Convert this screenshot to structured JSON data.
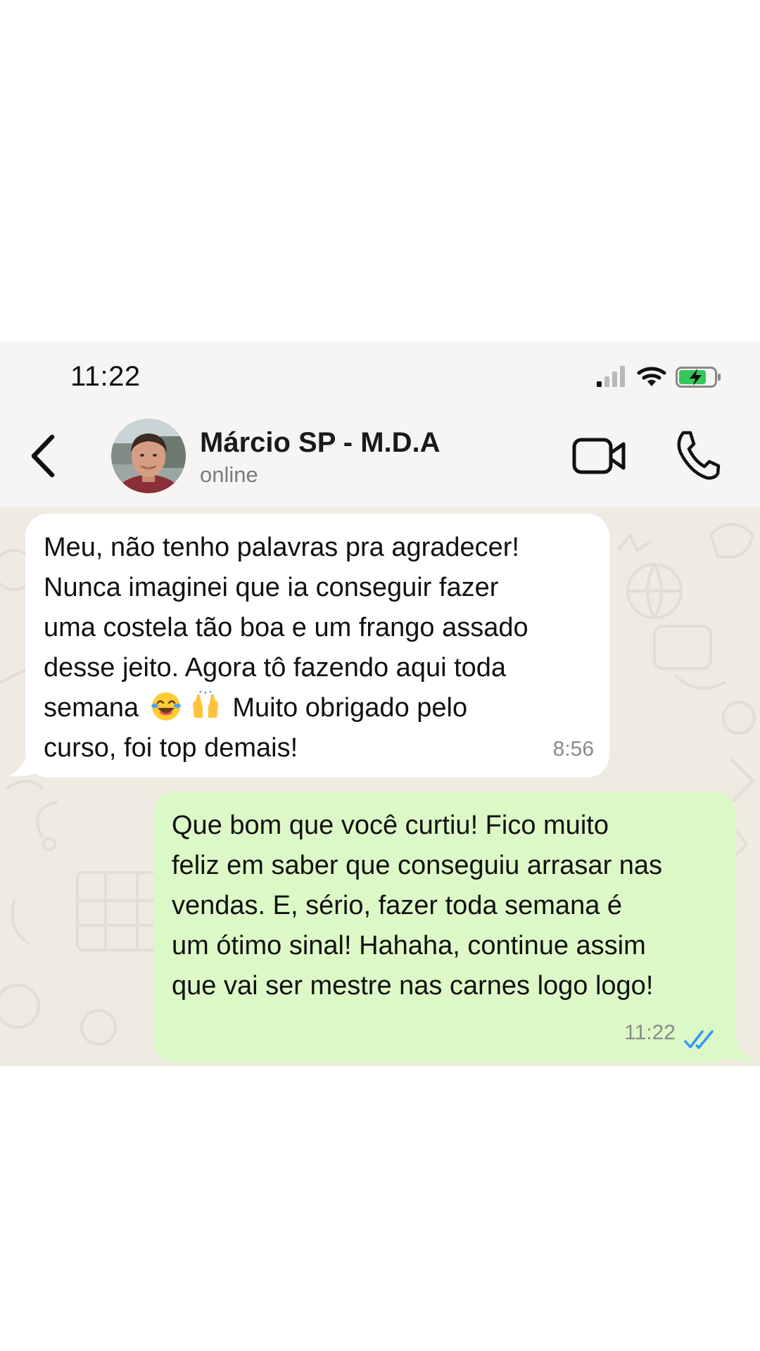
{
  "status_bar": {
    "time": "11:22",
    "icons": [
      "signal-icon",
      "wifi-icon",
      "battery-charging-icon"
    ]
  },
  "header": {
    "contact_name": "Márcio SP - M.D.A",
    "contact_status": "online",
    "icons": [
      "back-icon",
      "video-call-icon",
      "phone-call-icon"
    ]
  },
  "messages": [
    {
      "direction": "incoming",
      "text_part1": "Meu, não tenho palavras pra agradecer!\nNunca imaginei que ia conseguir fazer\numa costela tão boa e um frango assado\ndesse jeito. Agora tô fazendo aqui  toda\nsemana",
      "emojis": [
        "😂",
        "🙌"
      ],
      "text_part2": " Muito obrigado pelo\ncurso, foi top demais!",
      "time": "8:56"
    },
    {
      "direction": "outgoing",
      "text": "Que bom que você curtiu!  Fico muito\nfeliz em saber que conseguiu arrasar nas\nvendas. E, sério, fazer toda semana é\num ótimo sinal! Hahaha, continue assim\nque vai ser mestre nas carnes logo logo!",
      "time": "11:22",
      "status": "read"
    }
  ],
  "colors": {
    "header_bg": "#f6f5f3",
    "chat_bg": "#efeae2",
    "incoming_bubble": "#ffffff",
    "outgoing_bubble": "#dcf8c6",
    "read_tick": "#3497f9",
    "battery_fill": "#34c759"
  }
}
